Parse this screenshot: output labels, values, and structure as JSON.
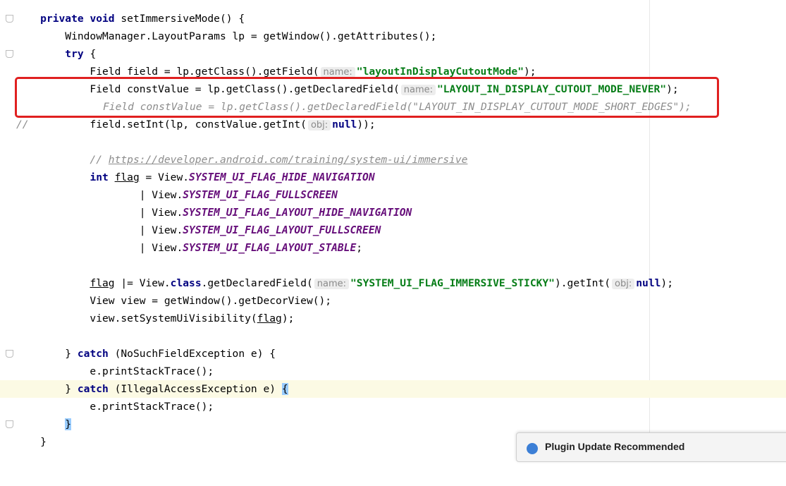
{
  "editor": {
    "lines": [
      {
        "text": "    private void setImmersiveMode() {"
      },
      {
        "text": "        WindowManager.LayoutParams lp = getWindow().getAttributes();"
      },
      {
        "text": "        try {"
      },
      {
        "text": "            Field field = lp.getClass().getField("
      },
      {
        "text": "            Field constValue = lp.getClass().getDeclaredField("
      },
      {
        "text": "//            Field constValue = lp.getClass().getDeclaredField(\"LAYOUT_IN_DISPLAY_CUTOUT_MODE_SHORT_EDGES\");"
      },
      {
        "text": "            field.setInt(lp, constValue.getInt("
      },
      {
        "text": "            // https://developer.android.com/training/system-ui/immersive"
      },
      {
        "text": "            int flag = View.SYSTEM_UI_FLAG_HIDE_NAVIGATION"
      }
    ],
    "hint_name": "name:",
    "hint_obj": "obj:",
    "str_cutout": "\"layoutInDisplayCutoutMode\"",
    "str_never": "\"LAYOUT_IN_DISPLAY_CUTOUT_MODE_NEVER\"",
    "str_sticky": "\"SYSTEM_UI_FLAG_IMMERSIVE_STICKY\"",
    "comment_url": "https://developer.android.com/training/system-ui/immersive",
    "commented_line": "Field constValue = lp.getClass().getDeclaredField(\"LAYOUT_IN_DISPLAY_CUTOUT_MODE_SHORT_EDGES\");",
    "const_hide_nav": "SYSTEM_UI_FLAG_HIDE_NAVIGATION",
    "const_fullscreen": "SYSTEM_UI_FLAG_FULLSCREEN",
    "const_layout_hide_nav": "SYSTEM_UI_FLAG_LAYOUT_HIDE_NAVIGATION",
    "const_layout_fullscreen": "SYSTEM_UI_FLAG_LAYOUT_FULLSCREEN",
    "const_layout_stable": "SYSTEM_UI_FLAG_LAYOUT_STABLE",
    "exc1": "NoSuchFieldException",
    "exc2": "IllegalAccessException"
  },
  "notification": {
    "title": "Plugin Update Recommended"
  },
  "colors": {
    "keyword": "#000080",
    "string": "#067d17",
    "constant": "#660e7a",
    "comment": "#8c8c8c",
    "highlight_box": "#e02020"
  }
}
